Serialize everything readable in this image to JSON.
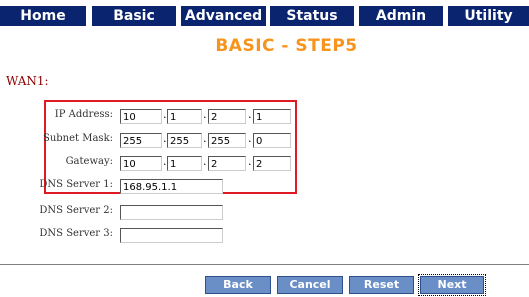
{
  "nav": {
    "tabs": [
      {
        "label": "Home"
      },
      {
        "label": "Basic"
      },
      {
        "label": "Advanced"
      },
      {
        "label": "Status"
      },
      {
        "label": "Admin"
      },
      {
        "label": "Utility"
      }
    ]
  },
  "page": {
    "title": "BASIC - STEP5",
    "section_label": "WAN1:"
  },
  "form": {
    "ip": {
      "label": "IP Address:",
      "octets": [
        "10",
        "1",
        "2",
        "1"
      ]
    },
    "mask": {
      "label": "Subnet Mask:",
      "octets": [
        "255",
        "255",
        "255",
        "0"
      ]
    },
    "gateway": {
      "label": "Gateway:",
      "octets": [
        "10",
        "1",
        "2",
        "2"
      ]
    },
    "dns1": {
      "label": "DNS Server 1:",
      "value": "168.95.1.1"
    },
    "dns2": {
      "label": "DNS Server 2:",
      "value": ""
    },
    "dns3": {
      "label": "DNS Server 3:",
      "value": ""
    },
    "separator": "."
  },
  "buttons": {
    "back": "Back",
    "cancel": "Cancel",
    "reset": "Reset",
    "next": "Next"
  },
  "colors": {
    "nav_bg": "#0a2470",
    "title": "#f7941d",
    "highlight_border": "#e01a22",
    "button_bg": "#6a8fc7"
  }
}
